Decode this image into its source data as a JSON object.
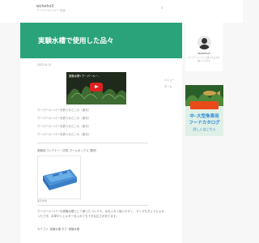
{
  "header": {
    "site_title": "wcheho3",
    "site_subtitle": "ウーパールーパー 日記",
    "menu_label": "メニュー"
  },
  "hero": {
    "title": "実験水槽で使用した品々"
  },
  "article": {
    "date": "2023.01.01",
    "video_title": "実験水槽1 ウーパールー…",
    "links": [
      "ウーパールーパーを飼うならこれ（楽天）",
      "ウーパールーパーを飼うならこれ（楽天）",
      "ウーパールーパーを飼うならこれ（楽天）",
      "ウーパールーパーを飼うならこれ（楽天）"
    ],
    "section_label": "実験用コンテナー（天馬 ホームボックス 透明）",
    "image_caption": "楽天市場",
    "paragraph": "ウーパールーパーの実験水槽として使ったコンテナ。水を入れて使いやすく、サイズもちょうどよかったです。水草やシェルターを入れても十分な広さがあります。",
    "tags": "カテゴリ: 実験水槽  タグ: 実験水槽"
  },
  "side_menu": {
    "items": [
      "メニュー",
      "ホーム"
    ]
  },
  "profile": {
    "name": "wcheho3",
    "description": "ウーパールーパーと暮らす日々を綴っています"
  },
  "ad": {
    "line1": "中~大型魚専用",
    "line2": "フードカタログ",
    "line3": "詳しくはこちら"
  },
  "colors": {
    "hero_bg": "#2aa37a",
    "ad_accent": "#2e8ad6",
    "badge": "#e94a1a"
  }
}
